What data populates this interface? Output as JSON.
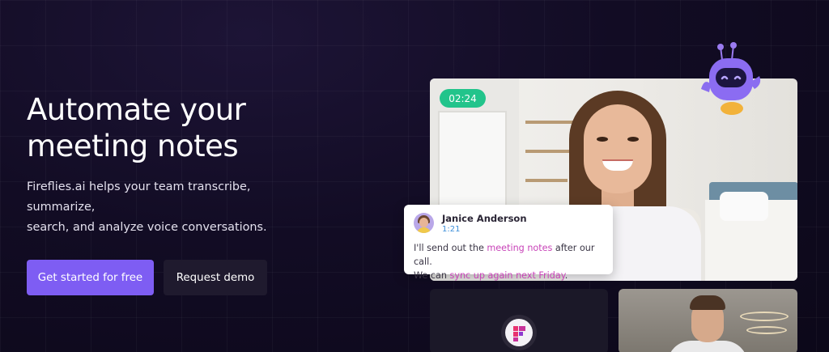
{
  "hero": {
    "headline_line1": "Automate your",
    "headline_line2": "meeting notes",
    "subtext_line1": "Fireflies.ai helps your team transcribe, summarize,",
    "subtext_line2": "search, and analyze voice conversations.",
    "primary_button": "Get started for free",
    "secondary_button": "Request demo"
  },
  "video": {
    "timer": "02:24"
  },
  "chat": {
    "name": "Janice Anderson",
    "time": "1:21",
    "line1_pre": "I'll send out the ",
    "line1_highlight": "meeting notes",
    "line1_post": " after our call.",
    "line2_pre": "We can ",
    "line2_highlight": "sync up again next Friday",
    "line2_post": "."
  },
  "icons": {
    "mascot": "robot-mascot-icon",
    "logo": "fireflies-logo-icon"
  },
  "colors": {
    "accent": "#7e5df3",
    "timer": "#22c48b",
    "highlight": "#c843b8",
    "background": "#120c24"
  }
}
